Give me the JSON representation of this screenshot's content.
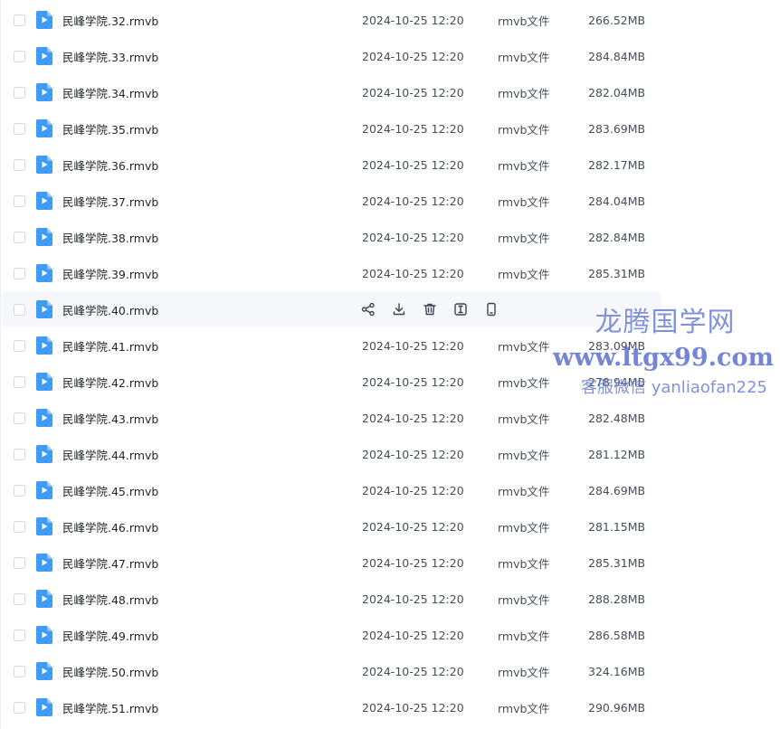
{
  "colors": {
    "accent": "#3f9cf6",
    "icon_gray": "#3d4450",
    "watermark": "#6c7fd6"
  },
  "files": [
    {
      "name": "民峰学院.32.rmvb",
      "date": "2024-10-25 12:20",
      "type": "rmvb文件",
      "size": "266.52MB"
    },
    {
      "name": "民峰学院.33.rmvb",
      "date": "2024-10-25 12:20",
      "type": "rmvb文件",
      "size": "284.84MB"
    },
    {
      "name": "民峰学院.34.rmvb",
      "date": "2024-10-25 12:20",
      "type": "rmvb文件",
      "size": "282.04MB"
    },
    {
      "name": "民峰学院.35.rmvb",
      "date": "2024-10-25 12:20",
      "type": "rmvb文件",
      "size": "283.69MB"
    },
    {
      "name": "民峰学院.36.rmvb",
      "date": "2024-10-25 12:20",
      "type": "rmvb文件",
      "size": "282.17MB"
    },
    {
      "name": "民峰学院.37.rmvb",
      "date": "2024-10-25 12:20",
      "type": "rmvb文件",
      "size": "284.04MB"
    },
    {
      "name": "民峰学院.38.rmvb",
      "date": "2024-10-25 12:20",
      "type": "rmvb文件",
      "size": "282.84MB"
    },
    {
      "name": "民峰学院.39.rmvb",
      "date": "2024-10-25 12:20",
      "type": "rmvb文件",
      "size": "285.31MB"
    },
    {
      "name": "民峰学院.40.rmvb",
      "hovered": true,
      "actions": [
        "share-icon",
        "download-icon",
        "delete-icon",
        "rename-icon",
        "mobile-icon"
      ]
    },
    {
      "name": "民峰学院.41.rmvb",
      "date": "2024-10-25 12:20",
      "type": "rmvb文件",
      "size": "283.09MB"
    },
    {
      "name": "民峰学院.42.rmvb",
      "date": "2024-10-25 12:20",
      "type": "rmvb文件",
      "size": "278.94MB"
    },
    {
      "name": "民峰学院.43.rmvb",
      "date": "2024-10-25 12:20",
      "type": "rmvb文件",
      "size": "282.48MB"
    },
    {
      "name": "民峰学院.44.rmvb",
      "date": "2024-10-25 12:20",
      "type": "rmvb文件",
      "size": "281.12MB"
    },
    {
      "name": "民峰学院.45.rmvb",
      "date": "2024-10-25 12:20",
      "type": "rmvb文件",
      "size": "284.69MB"
    },
    {
      "name": "民峰学院.46.rmvb",
      "date": "2024-10-25 12:20",
      "type": "rmvb文件",
      "size": "281.15MB"
    },
    {
      "name": "民峰学院.47.rmvb",
      "date": "2024-10-25 12:20",
      "type": "rmvb文件",
      "size": "285.31MB"
    },
    {
      "name": "民峰学院.48.rmvb",
      "date": "2024-10-25 12:20",
      "type": "rmvb文件",
      "size": "288.28MB"
    },
    {
      "name": "民峰学院.49.rmvb",
      "date": "2024-10-25 12:20",
      "type": "rmvb文件",
      "size": "286.58MB"
    },
    {
      "name": "民峰学院.50.rmvb",
      "date": "2024-10-25 12:20",
      "type": "rmvb文件",
      "size": "324.16MB"
    },
    {
      "name": "民峰学院.51.rmvb",
      "date": "2024-10-25 12:20",
      "type": "rmvb文件",
      "size": "290.96MB"
    }
  ],
  "watermark": {
    "title": "龙腾国学网",
    "url": "www.ltgx99.com",
    "wechat": "客服微信 yanliaofan225"
  }
}
